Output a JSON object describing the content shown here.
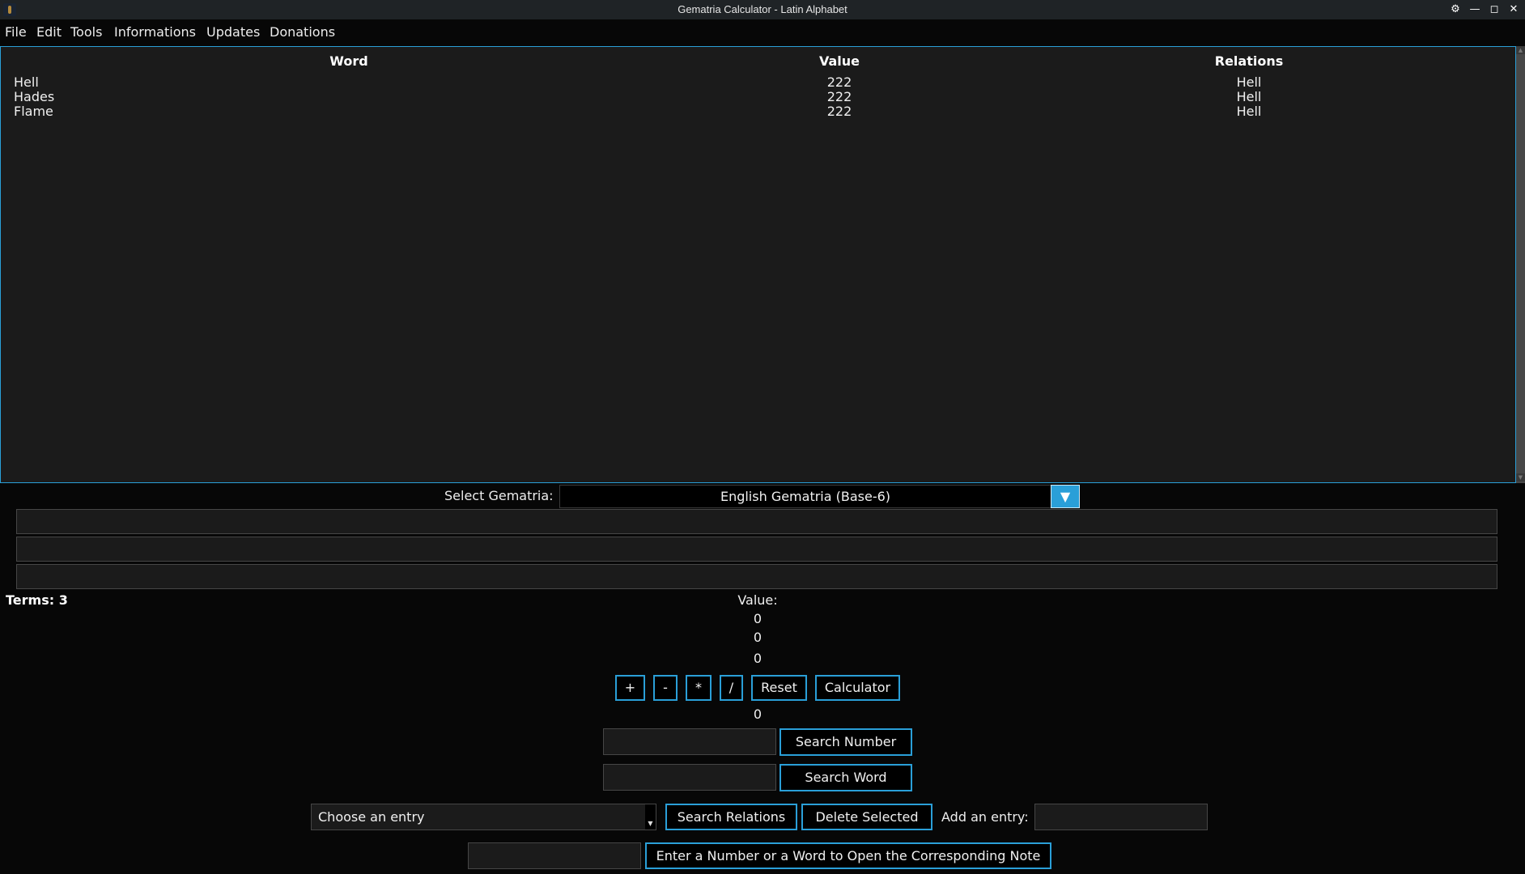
{
  "window": {
    "title": "Gematria Calculator - Latin Alphabet",
    "controls": [
      "settings",
      "minimize",
      "maximize",
      "close"
    ]
  },
  "menu": [
    "File",
    "Edit",
    "Tools",
    "Informations",
    "Updates",
    "Donations"
  ],
  "table": {
    "headers": [
      "Word",
      "Value",
      "Relations"
    ],
    "rows": [
      {
        "word": "Hell",
        "value": "222",
        "relation": "Hell"
      },
      {
        "word": "Hades",
        "value": "222",
        "relation": "Hell"
      },
      {
        "word": "Flame",
        "value": "222",
        "relation": "Hell"
      }
    ]
  },
  "gematria": {
    "label": "Select Gematria:",
    "selected": "English Gematria (Base-6)",
    "arrow": "▼"
  },
  "terms": "Terms: 3",
  "values": {
    "label": "Value:",
    "v1": "0",
    "v2": "0",
    "v3": "0",
    "result": "0"
  },
  "operators": {
    "plus": "+",
    "minus": "-",
    "multiply": "*",
    "divide": "/",
    "reset": "Reset",
    "calculator": "Calculator"
  },
  "search": {
    "number_button": "Search Number",
    "word_button": "Search Word",
    "number_value": "",
    "word_value": ""
  },
  "relations": {
    "combo_placeholder": "Choose an entry",
    "search_relations": "Search Relations",
    "delete_selected": "Delete Selected",
    "add_label": "Add an entry:",
    "add_value": ""
  },
  "note": {
    "button": "Enter a Number or a Word to Open the Corresponding Note",
    "value": ""
  },
  "colors": {
    "accent": "#2a9fd8",
    "background": "#070707",
    "panel": "#1b1b1b"
  }
}
